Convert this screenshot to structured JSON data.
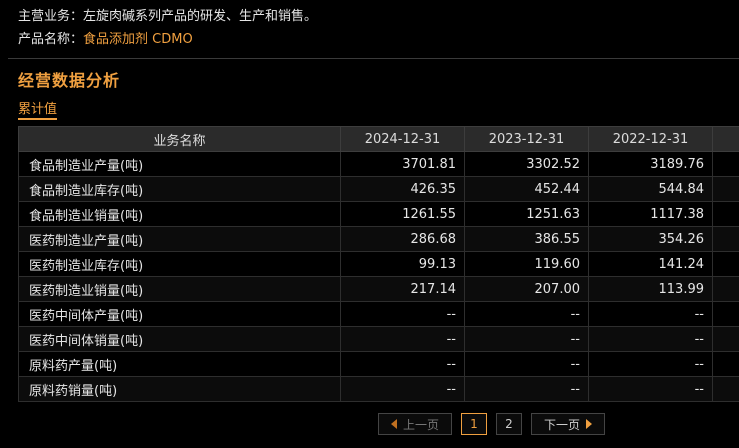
{
  "company": {
    "main_business_label": "主营业务：",
    "main_business_value": "左旋肉碱系列产品的研发、生产和销售。",
    "product_label": "产品名称：",
    "product_value": "食品添加剂 CDMO"
  },
  "section": {
    "title": "经营数据分析",
    "tab_label": "累计值"
  },
  "table": {
    "headers": [
      "业务名称",
      "2024-12-31",
      "2023-12-31",
      "2022-12-31",
      ""
    ],
    "rows": [
      [
        "食品制造业产量(吨)",
        "3701.81",
        "3302.52",
        "3189.76",
        ""
      ],
      [
        "食品制造业库存(吨)",
        "426.35",
        "452.44",
        "544.84",
        ""
      ],
      [
        "食品制造业销量(吨)",
        "1261.55",
        "1251.63",
        "1117.38",
        ""
      ],
      [
        "医药制造业产量(吨)",
        "286.68",
        "386.55",
        "354.26",
        ""
      ],
      [
        "医药制造业库存(吨)",
        "99.13",
        "119.60",
        "141.24",
        ""
      ],
      [
        "医药制造业销量(吨)",
        "217.14",
        "207.00",
        "113.99",
        ""
      ],
      [
        "医药中间体产量(吨)",
        "--",
        "--",
        "--",
        ""
      ],
      [
        "医药中间体销量(吨)",
        "--",
        "--",
        "--",
        ""
      ],
      [
        "原料药产量(吨)",
        "--",
        "--",
        "--",
        ""
      ],
      [
        "原料药销量(吨)",
        "--",
        "--",
        "--",
        ""
      ]
    ]
  },
  "pager": {
    "prev_label": "上一页",
    "pages": [
      "1",
      "2"
    ],
    "current_page": "1",
    "next_label": "下一页",
    "prev_icon": "triangle-left-icon",
    "next_icon": "triangle-right-icon"
  },
  "colors": {
    "accent": "#f0a040",
    "background": "#000000",
    "header_bg": "#2b2b2b"
  }
}
